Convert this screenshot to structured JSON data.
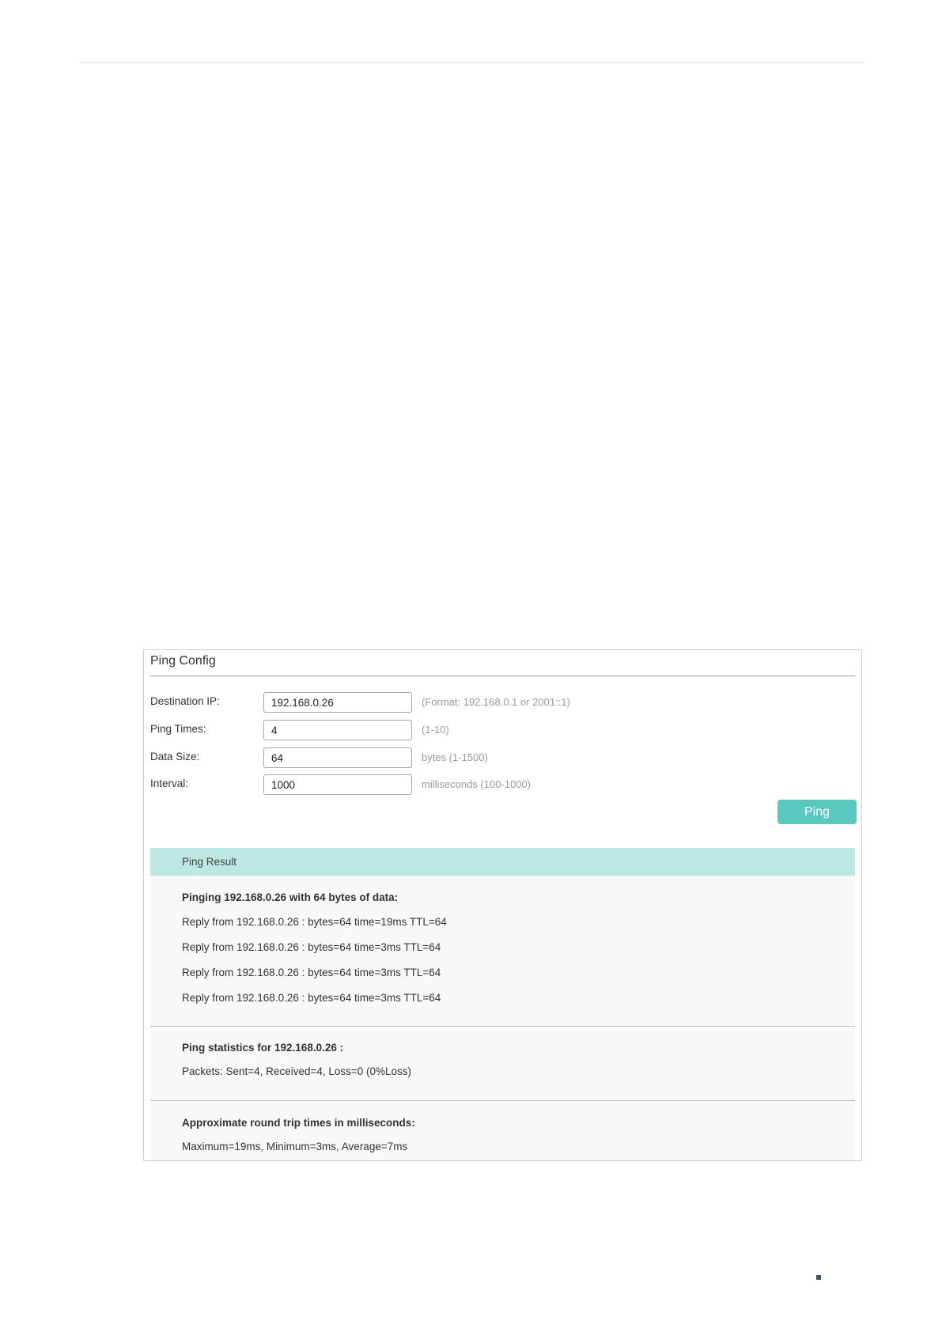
{
  "panel": {
    "title": "Ping Config"
  },
  "form": {
    "destination_ip": {
      "label": "Destination IP:",
      "value": "192.168.0.26",
      "hint": "(Format: 192.168.0.1 or 2001::1)"
    },
    "ping_times": {
      "label": "Ping Times:",
      "value": "4",
      "hint": "(1-10)"
    },
    "data_size": {
      "label": "Data Size:",
      "value": "64",
      "hint": "bytes (1-1500)"
    },
    "interval": {
      "label": "Interval:",
      "value": "1000",
      "hint": "milliseconds (100-1000)"
    },
    "ping_button": "Ping"
  },
  "result": {
    "header": "Ping Result",
    "pinging": "Pinging 192.168.0.26 with 64 bytes of data:",
    "replies": [
      "Reply from 192.168.0.26 : bytes=64 time=19ms TTL=64",
      "Reply from 192.168.0.26 : bytes=64 time=3ms TTL=64",
      "Reply from 192.168.0.26 : bytes=64 time=3ms TTL=64",
      "Reply from 192.168.0.26 : bytes=64 time=3ms TTL=64"
    ],
    "stats_title": "Ping statistics for 192.168.0.26 :",
    "stats_line": "Packets: Sent=4, Received=4, Loss=0 (0%Loss)",
    "rtt_title": "Approximate round trip times in milliseconds:",
    "rtt_line": "Maximum=19ms, Minimum=3ms, Average=7ms"
  },
  "colors": {
    "accent": "#5ac8c0",
    "result_header_bg": "#bde8e2",
    "result_body_bg": "#f8f8f8"
  }
}
